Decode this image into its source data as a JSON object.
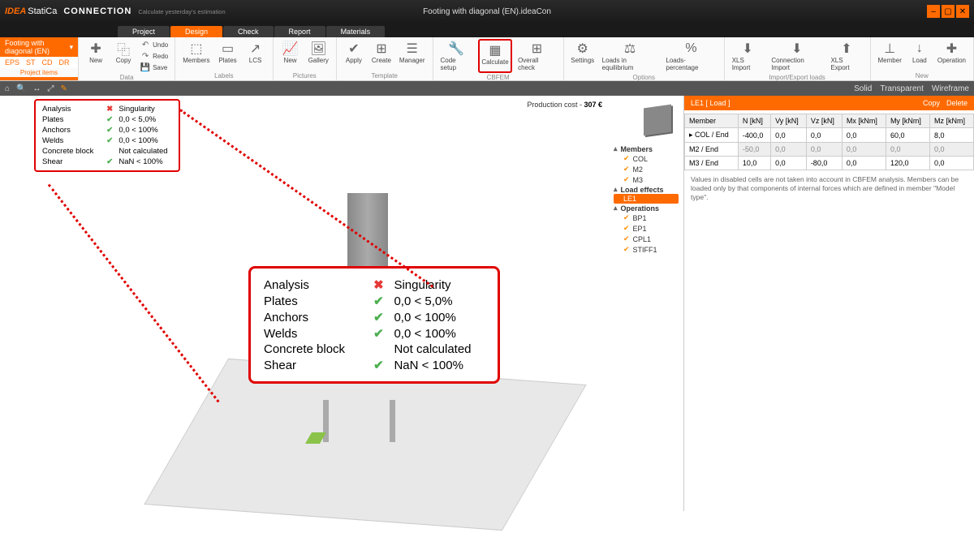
{
  "title": {
    "brand1": "IDEA",
    "brand2": "StatiCa",
    "app": "CONNECTION",
    "tagline": "Calculate yesterday's estimation",
    "doc": "Footing with diagonal (EN).ideaCon"
  },
  "tabs": {
    "project": "Project",
    "design": "Design",
    "check": "Check",
    "report": "Report",
    "materials": "Materials"
  },
  "projectitem": {
    "name": "Footing with diagonal (EN)",
    "sub": [
      "EPS",
      "ST",
      "CD",
      "DR"
    ],
    "label": "Project items"
  },
  "rib": {
    "new": "New",
    "copy": "Copy",
    "undo": "Undo",
    "redo": "Redo",
    "save": "Save",
    "data": "Data",
    "members": "Members",
    "plates": "Plates",
    "lcs": "LCS",
    "labels": "Labels",
    "pnew": "New",
    "gallery": "Gallery",
    "pictures": "Pictures",
    "apply": "Apply",
    "create": "Create",
    "manager": "Manager",
    "template": "Template",
    "codesetup": "Code setup",
    "calculate": "Calculate",
    "overall": "Overall check",
    "cbfem": "CBFEM",
    "settings": "Settings",
    "loadseq": "Loads in equilibrium",
    "loadspct": "Loads-percentage",
    "options": "Options",
    "xlsimp": "XLS Import",
    "connimp": "Connection Import",
    "xlsexp": "XLS Export",
    "impexp": "Import/Export loads",
    "member": "Member",
    "load": "Load",
    "operation": "Operation",
    "newg": "New"
  },
  "viewbar": {
    "solid": "Solid",
    "transparent": "Transparent",
    "wireframe": "Wireframe"
  },
  "prodcost": {
    "label": "Production cost  -",
    "value": "307 €"
  },
  "tree": {
    "members": "Members",
    "m": [
      "COL",
      "M2",
      "M3"
    ],
    "loadeff": "Load effects",
    "le": "LE1",
    "ops": "Operations",
    "op": [
      "BP1",
      "EP1",
      "CPL1",
      "STIFF1"
    ]
  },
  "results": [
    {
      "label": "Analysis",
      "ok": false,
      "value": "Singularity"
    },
    {
      "label": "Plates",
      "ok": true,
      "value": "0,0 < 5,0%"
    },
    {
      "label": "Anchors",
      "ok": true,
      "value": "0,0 < 100%"
    },
    {
      "label": "Welds",
      "ok": true,
      "value": "0,0 < 100%"
    },
    {
      "label": "Concrete block",
      "ok": null,
      "value": "Not calculated"
    },
    {
      "label": "Shear",
      "ok": true,
      "value": "NaN < 100%"
    }
  ],
  "side": {
    "hdr": "LE1 [ Load ]",
    "copy": "Copy",
    "del": "Delete",
    "cols": [
      "Member",
      "N [kN]",
      "Vy [kN]",
      "Vz [kN]",
      "Mx [kNm]",
      "My [kNm]",
      "Mz [kNm]"
    ],
    "rows": [
      {
        "m": "COL / End",
        "n": "-400,0",
        "vy": "0,0",
        "vz": "0,0",
        "mx": "0,0",
        "my": "60,0",
        "mz": "8,0",
        "d": false
      },
      {
        "m": "M2 / End",
        "n": "-50,0",
        "vy": "0,0",
        "vz": "0,0",
        "mx": "0,0",
        "my": "0,0",
        "mz": "0,0",
        "d": true
      },
      {
        "m": "M3 / End",
        "n": "10,0",
        "vy": "0,0",
        "vz": "-80,0",
        "mx": "0,0",
        "my": "120,0",
        "mz": "0,0",
        "d": false
      }
    ],
    "note": "Values in disabled cells are not taken into account in CBFEM analysis. Members can be loaded only by that components of internal forces which are defined in member \"Model type\"."
  }
}
